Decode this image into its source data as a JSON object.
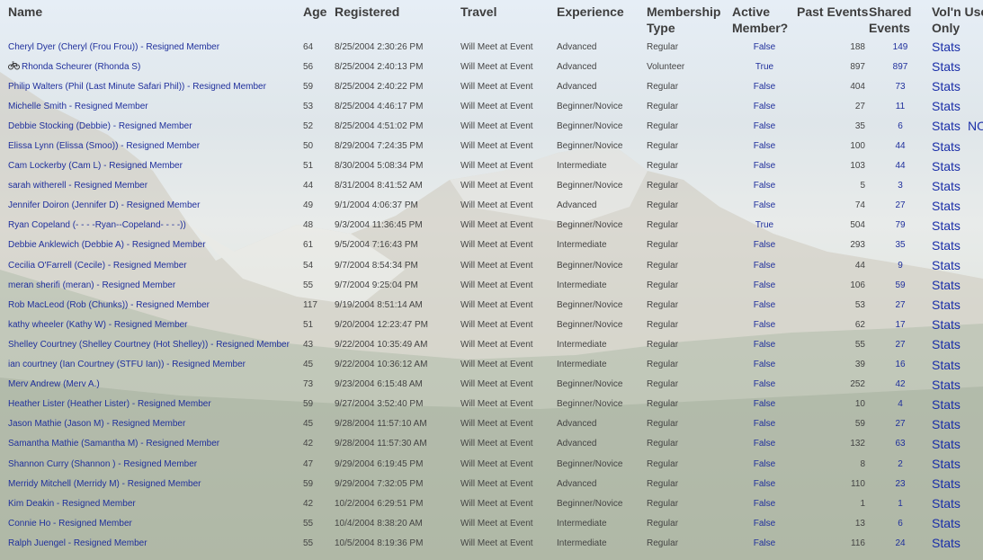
{
  "headers": {
    "name": "Name",
    "age": "Age",
    "registered": "Registered",
    "travel": "Travel",
    "experience": "Experience",
    "membership_type": "Membership Type",
    "active_member": "Active Member?",
    "past_events": "Past Events",
    "shared_events": "Shared Events",
    "voln_use_only": "Vol'n Use Only"
  },
  "rows": [
    {
      "name": "Cheryl Dyer (Cheryl (Frou Frou)) - Resigned Member",
      "age": "64",
      "registered": "8/25/2004 2:30:26 PM",
      "travel": "Will Meet at Event",
      "experience": "Advanced",
      "membership": "Regular",
      "active": "False",
      "past": "188",
      "shared": "149",
      "stats": "Stats",
      "vol": ""
    },
    {
      "name": "Rhonda Scheurer (Rhonda S)",
      "icon": "bicycle-icon",
      "age": "56",
      "registered": "8/25/2004 2:40:13 PM",
      "travel": "Will Meet at Event",
      "experience": "Advanced",
      "membership": "Volunteer",
      "active": "True",
      "past": "897",
      "shared": "897",
      "stats": "Stats",
      "vol": ""
    },
    {
      "name": "Philip Walters (Phil (Last Minute Safari Phil)) - Resigned Member",
      "age": "59",
      "registered": "8/25/2004 2:40:22 PM",
      "travel": "Will Meet at Event",
      "experience": "Advanced",
      "membership": "Regular",
      "active": "False",
      "past": "404",
      "shared": "73",
      "stats": "Stats",
      "vol": ""
    },
    {
      "name": "Michelle Smith - Resigned Member",
      "age": "53",
      "registered": "8/25/2004 4:46:17 PM",
      "travel": "Will Meet at Event",
      "experience": "Beginner/Novice",
      "membership": "Regular",
      "active": "False",
      "past": "27",
      "shared": "11",
      "stats": "Stats",
      "vol": ""
    },
    {
      "name": "Debbie Stocking (Debbie) - Resigned Member",
      "age": "52",
      "registered": "8/25/2004 4:51:02 PM",
      "travel": "Will Meet at Event",
      "experience": "Beginner/Novice",
      "membership": "Regular",
      "active": "False",
      "past": "35",
      "shared": "6",
      "stats": "Stats",
      "vol": "NO"
    },
    {
      "name": "Elissa Lynn (Elissa (Smoo)) - Resigned Member",
      "age": "50",
      "registered": "8/29/2004 7:24:35 PM",
      "travel": "Will Meet at Event",
      "experience": "Beginner/Novice",
      "membership": "Regular",
      "active": "False",
      "past": "100",
      "shared": "44",
      "stats": "Stats",
      "vol": ""
    },
    {
      "name": "Cam Lockerby (Cam L) - Resigned Member",
      "age": "51",
      "registered": "8/30/2004 5:08:34 PM",
      "travel": "Will Meet at Event",
      "experience": "Intermediate",
      "membership": "Regular",
      "active": "False",
      "past": "103",
      "shared": "44",
      "stats": "Stats",
      "vol": ""
    },
    {
      "name": "sarah witherell - Resigned Member",
      "age": "44",
      "registered": "8/31/2004 8:41:52 AM",
      "travel": "Will Meet at Event",
      "experience": "Beginner/Novice",
      "membership": "Regular",
      "active": "False",
      "past": "5",
      "shared": "3",
      "stats": "Stats",
      "vol": ""
    },
    {
      "name": "Jennifer Doiron (Jennifer D) - Resigned Member",
      "age": "49",
      "registered": "9/1/2004 4:06:37 PM",
      "travel": "Will Meet at Event",
      "experience": "Advanced",
      "membership": "Regular",
      "active": "False",
      "past": "74",
      "shared": "27",
      "stats": "Stats",
      "vol": ""
    },
    {
      "name": "Ryan Copeland (- - - -Ryan--Copeland- - - -))",
      "age": "48",
      "registered": "9/3/2004 11:36:45 PM",
      "travel": "Will Meet at Event",
      "experience": "Beginner/Novice",
      "membership": "Regular",
      "active": "True",
      "past": "504",
      "shared": "79",
      "stats": "Stats",
      "vol": ""
    },
    {
      "name": "Debbie Anklewich (Debbie A) - Resigned Member",
      "age": "61",
      "registered": "9/5/2004 7:16:43 PM",
      "travel": "Will Meet at Event",
      "experience": "Intermediate",
      "membership": "Regular",
      "active": "False",
      "past": "293",
      "shared": "35",
      "stats": "Stats",
      "vol": ""
    },
    {
      "name": "Cecilia O'Farrell (Cecile) - Resigned Member",
      "age": "54",
      "registered": "9/7/2004 8:54:34 PM",
      "travel": "Will Meet at Event",
      "experience": "Beginner/Novice",
      "membership": "Regular",
      "active": "False",
      "past": "44",
      "shared": "9",
      "stats": "Stats",
      "vol": ""
    },
    {
      "name": "meran sherifi (meran) - Resigned Member",
      "age": "55",
      "registered": "9/7/2004 9:25:04 PM",
      "travel": "Will Meet at Event",
      "experience": "Intermediate",
      "membership": "Regular",
      "active": "False",
      "past": "106",
      "shared": "59",
      "stats": "Stats",
      "vol": ""
    },
    {
      "name": "Rob MacLeod (Rob (Chunks)) - Resigned Member",
      "age": "117",
      "registered": "9/19/2004 8:51:14 AM",
      "travel": "Will Meet at Event",
      "experience": "Beginner/Novice",
      "membership": "Regular",
      "active": "False",
      "past": "53",
      "shared": "27",
      "stats": "Stats",
      "vol": ""
    },
    {
      "name": "kathy wheeler (Kathy W) - Resigned Member",
      "age": "51",
      "registered": "9/20/2004 12:23:47 PM",
      "travel": "Will Meet at Event",
      "experience": "Beginner/Novice",
      "membership": "Regular",
      "active": "False",
      "past": "62",
      "shared": "17",
      "stats": "Stats",
      "vol": ""
    },
    {
      "name": "Shelley Courtney (Shelley Courtney (Hot Shelley)) - Resigned Member",
      "age": "43",
      "registered": "9/22/2004 10:35:49 AM",
      "travel": "Will Meet at Event",
      "experience": "Intermediate",
      "membership": "Regular",
      "active": "False",
      "past": "55",
      "shared": "27",
      "stats": "Stats",
      "vol": ""
    },
    {
      "name": "ian courtney (Ian Courtney (STFU Ian)) - Resigned Member",
      "age": "45",
      "registered": "9/22/2004 10:36:12 AM",
      "travel": "Will Meet at Event",
      "experience": "Intermediate",
      "membership": "Regular",
      "active": "False",
      "past": "39",
      "shared": "16",
      "stats": "Stats",
      "vol": ""
    },
    {
      "name": "Merv Andrew (Merv A.)",
      "age": "73",
      "registered": "9/23/2004 6:15:48 AM",
      "travel": "Will Meet at Event",
      "experience": "Beginner/Novice",
      "membership": "Regular",
      "active": "False",
      "past": "252",
      "shared": "42",
      "stats": "Stats",
      "vol": ""
    },
    {
      "name": "Heather Lister (Heather Lister) - Resigned Member",
      "age": "59",
      "registered": "9/27/2004 3:52:40 PM",
      "travel": "Will Meet at Event",
      "experience": "Beginner/Novice",
      "membership": "Regular",
      "active": "False",
      "past": "10",
      "shared": "4",
      "stats": "Stats",
      "vol": ""
    },
    {
      "name": "Jason Mathie (Jason M) - Resigned Member",
      "age": "45",
      "registered": "9/28/2004 11:57:10 AM",
      "travel": "Will Meet at Event",
      "experience": "Advanced",
      "membership": "Regular",
      "active": "False",
      "past": "59",
      "shared": "27",
      "stats": "Stats",
      "vol": ""
    },
    {
      "name": "Samantha Mathie (Samantha M) - Resigned Member",
      "age": "42",
      "registered": "9/28/2004 11:57:30 AM",
      "travel": "Will Meet at Event",
      "experience": "Advanced",
      "membership": "Regular",
      "active": "False",
      "past": "132",
      "shared": "63",
      "stats": "Stats",
      "vol": ""
    },
    {
      "name": "Shannon Curry (Shannon ) - Resigned Member",
      "age": "47",
      "registered": "9/29/2004 6:19:45 PM",
      "travel": "Will Meet at Event",
      "experience": "Beginner/Novice",
      "membership": "Regular",
      "active": "False",
      "past": "8",
      "shared": "2",
      "stats": "Stats",
      "vol": ""
    },
    {
      "name": "Merridy Mitchell (Merridy M) - Resigned Member",
      "age": "59",
      "registered": "9/29/2004 7:32:05 PM",
      "travel": "Will Meet at Event",
      "experience": "Advanced",
      "membership": "Regular",
      "active": "False",
      "past": "110",
      "shared": "23",
      "stats": "Stats",
      "vol": ""
    },
    {
      "name": "Kim Deakin - Resigned Member",
      "age": "42",
      "registered": "10/2/2004 6:29:51 PM",
      "travel": "Will Meet at Event",
      "experience": "Beginner/Novice",
      "membership": "Regular",
      "active": "False",
      "past": "1",
      "shared": "1",
      "stats": "Stats",
      "vol": ""
    },
    {
      "name": "Connie Ho - Resigned Member",
      "age": "55",
      "registered": "10/4/2004 8:38:20 AM",
      "travel": "Will Meet at Event",
      "experience": "Intermediate",
      "membership": "Regular",
      "active": "False",
      "past": "13",
      "shared": "6",
      "stats": "Stats",
      "vol": ""
    },
    {
      "name": "Ralph Juengel - Resigned Member",
      "age": "55",
      "registered": "10/5/2004 8:19:36 PM",
      "travel": "Will Meet at Event",
      "experience": "Intermediate",
      "membership": "Regular",
      "active": "False",
      "past": "116",
      "shared": "24",
      "stats": "Stats",
      "vol": ""
    }
  ]
}
